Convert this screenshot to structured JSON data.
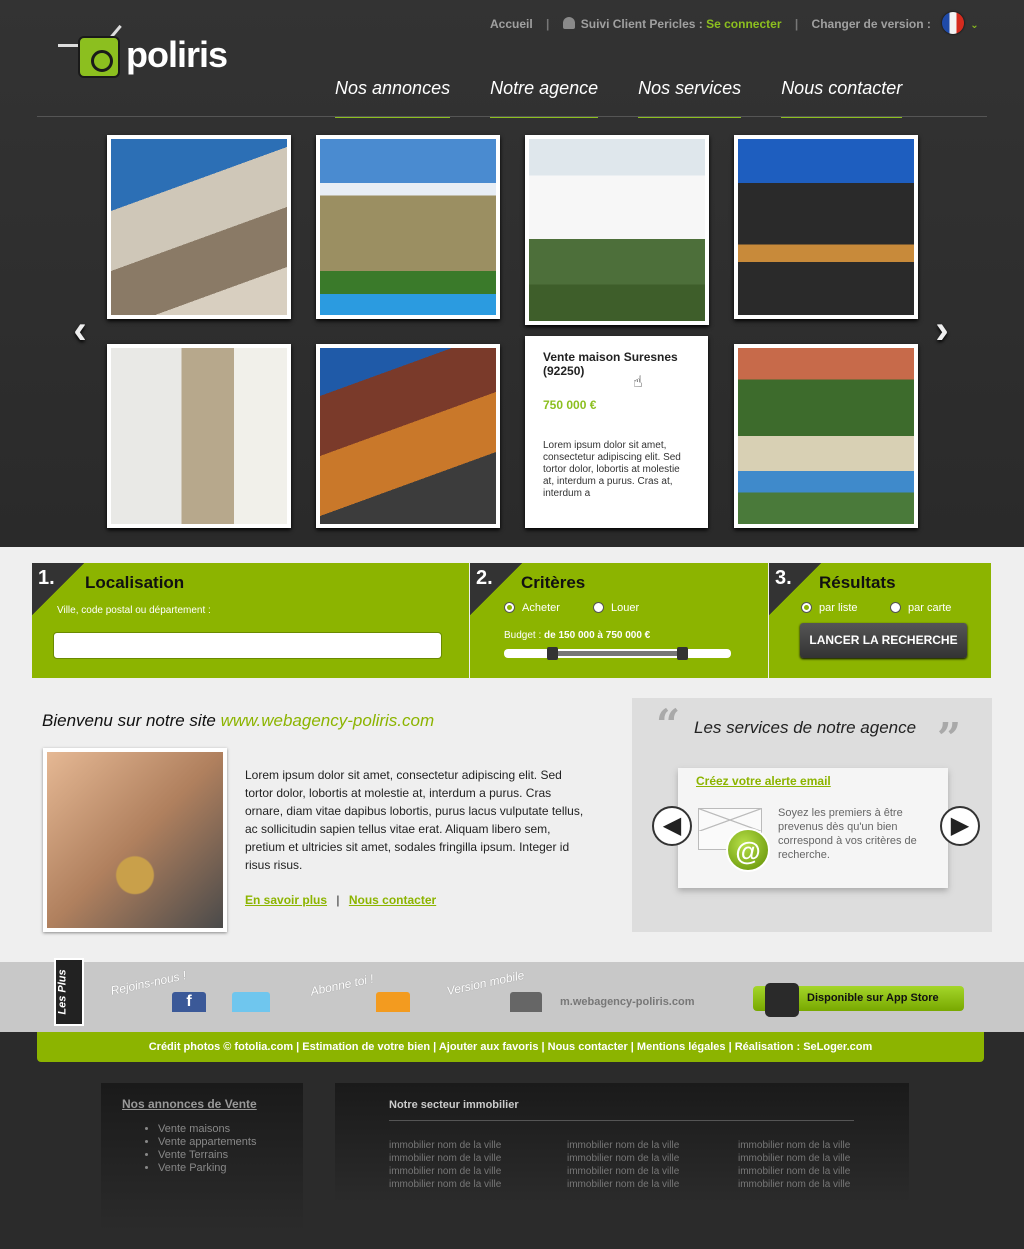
{
  "top_links": {
    "home": "Accueil",
    "client_label": "Suivi Client Pericles :",
    "connect": "Se connecter",
    "change_version": "Changer de version :"
  },
  "logo": {
    "text": "poliris"
  },
  "nav": [
    "Nos annonces",
    "Notre agence",
    "Nos services",
    "Nous contacter"
  ],
  "carousel": {
    "detail": {
      "title": "Vente maison Suresnes (92250)",
      "price": "750 000 €",
      "description": "Lorem ipsum dolor sit amet, consectetur adipiscing elit. Sed tortor dolor, lobortis at molestie at, interdum a purus. Cras at, interdum a"
    }
  },
  "search": {
    "step1": {
      "num": "1.",
      "title": "Localisation",
      "label": "Ville, code postal ou département :",
      "value": ""
    },
    "step2": {
      "num": "2.",
      "title": "Critères",
      "opt_buy": "Acheter",
      "opt_rent": "Louer",
      "budget_label": "Budget :",
      "budget_range": "de 150 000 à 750 000 €",
      "budget_low_fraction": 0.2,
      "budget_high_fraction": 0.8
    },
    "step3": {
      "num": "3.",
      "title": "Résultats",
      "opt_list": "par liste",
      "opt_map": "par carte",
      "button": "LANCER LA RECHERCHE"
    }
  },
  "welcome": {
    "prefix": "Bienvenu sur notre site",
    "site": "www.webagency-poliris.com",
    "text": "Lorem ipsum dolor sit amet, consectetur adipiscing elit. Sed tortor dolor, lobortis at molestie at, interdum a purus. Cras ornare, diam vitae dapibus lobortis, purus lacus vulputate tellus, ac sollicitudin sapien tellus vitae erat. Aliquam libero sem, pretium et ultricies sit amet, sodales fringilla ipsum. Integer id risus risus.",
    "link_more": "En savoir plus",
    "link_contact": "Nous contacter",
    "separator": "|"
  },
  "services": {
    "open_quote": "“",
    "close_quote": "”",
    "title": "Les services de notre agence",
    "link": "Créez votre alerte email",
    "text": "Soyez les premiers à être prevenus dès qu'un bien correspond à vos critères de recherche.",
    "at_symbol": "@"
  },
  "plus": {
    "tag": "Les Plus",
    "join": "Rejoins-nous !",
    "subscribe": "Abonne toi !",
    "mobile": "Version mobile",
    "mobile_url": "m.webagency-poliris.com",
    "fb_letter": "f",
    "appstore": "Disponible sur App Store",
    "apple_glyph": ""
  },
  "credits": "Crédit photos © fotolia.com | Estimation de votre bien | Ajouter aux favoris | Nous contacter | Mentions légales | Réalisation : SeLoger.com",
  "footer": {
    "sale_title": "Nos annonces de Vente",
    "sale_items": [
      "Vente maisons",
      "Vente appartements",
      "Vente Terrains",
      "Vente Parking"
    ],
    "sector_title": "Notre secteur immobilier",
    "sector_item": "immobilier nom de la ville"
  },
  "colors": {
    "accent": "#8cb400",
    "dark": "#2b2b2b"
  }
}
